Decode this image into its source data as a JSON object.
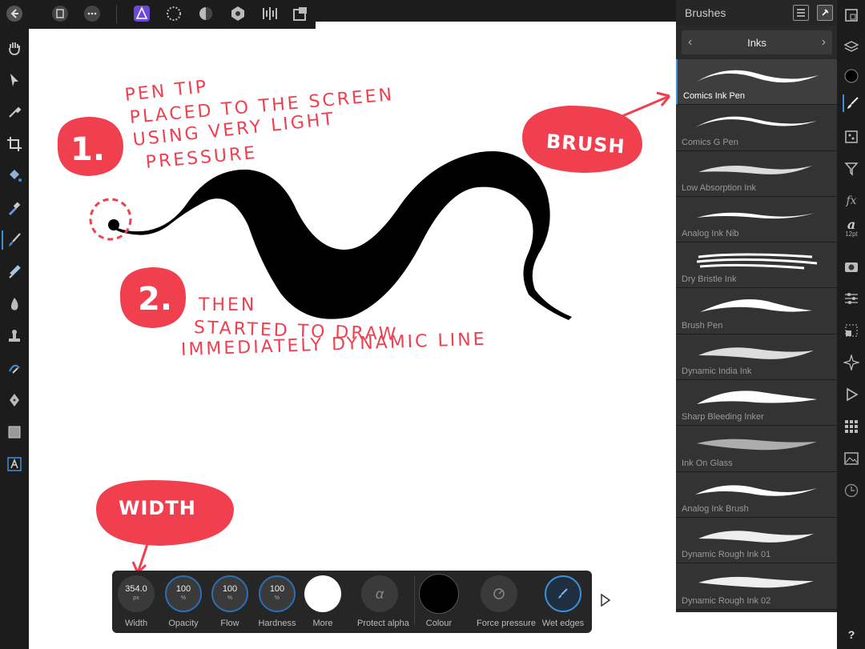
{
  "topbar": {
    "icons": [
      "back-icon",
      "document-icon",
      "more-icon",
      "designer-persona-icon",
      "pixel-persona-icon",
      "tone-mapping-persona-icon",
      "export-persona-icon",
      "assistant-icon",
      "arrange-icon"
    ]
  },
  "brushes_panel": {
    "title": "Brushes",
    "category": "Inks",
    "items": [
      {
        "name": "Comics Ink Pen"
      },
      {
        "name": "Comics G Pen"
      },
      {
        "name": "Low Absorption Ink"
      },
      {
        "name": "Analog Ink Nib"
      },
      {
        "name": "Dry Bristle Ink"
      },
      {
        "name": "Brush Pen"
      },
      {
        "name": "Dynamic India Ink"
      },
      {
        "name": "Sharp Bleeding Inker"
      },
      {
        "name": "Ink On Glass"
      },
      {
        "name": "Analog Ink Brush"
      },
      {
        "name": "Dynamic Rough Ink 01"
      },
      {
        "name": "Dynamic Rough Ink 02"
      }
    ],
    "selected": "Comics Ink Pen"
  },
  "context_toolbar": {
    "width": {
      "value": "354.0",
      "unit": "px",
      "label": "Width"
    },
    "opacity": {
      "value": "100",
      "unit": "%",
      "label": "Opacity"
    },
    "flow": {
      "value": "100",
      "unit": "%",
      "label": "Flow"
    },
    "hardness": {
      "value": "100",
      "unit": "%",
      "label": "Hardness"
    },
    "more": {
      "label": "More"
    },
    "protect_alpha": {
      "label": "Protect alpha",
      "glyph": "α"
    },
    "colour": {
      "label": "Colour",
      "value": "#000000"
    },
    "force_pressure": {
      "label": "Force pressure"
    },
    "wet_edges": {
      "label": "Wet edges"
    }
  },
  "right_strip": {
    "text_size": "12pt",
    "fx": "fx",
    "a_glyph": "a",
    "help": "?"
  },
  "annotations": {
    "step1_number": "1.",
    "step1_text": [
      "PEN TIP",
      "PLACED TO THE SCREEN",
      "USING VERY LIGHT",
      "PRESSURE"
    ],
    "step2_number": "2.",
    "step2_text": [
      "THEN",
      "STARTED TO DRAW",
      "IMMEDIATELY DYNAMIC LINE"
    ],
    "brush_callout": "BRUSH",
    "width_callout": "WIDTH"
  },
  "colors": {
    "accent": "#3b8fd9",
    "annotation_red": "#f0404f",
    "panel_bg": "#2a2a2a",
    "toolbar_bg": "#1c1c1c"
  }
}
